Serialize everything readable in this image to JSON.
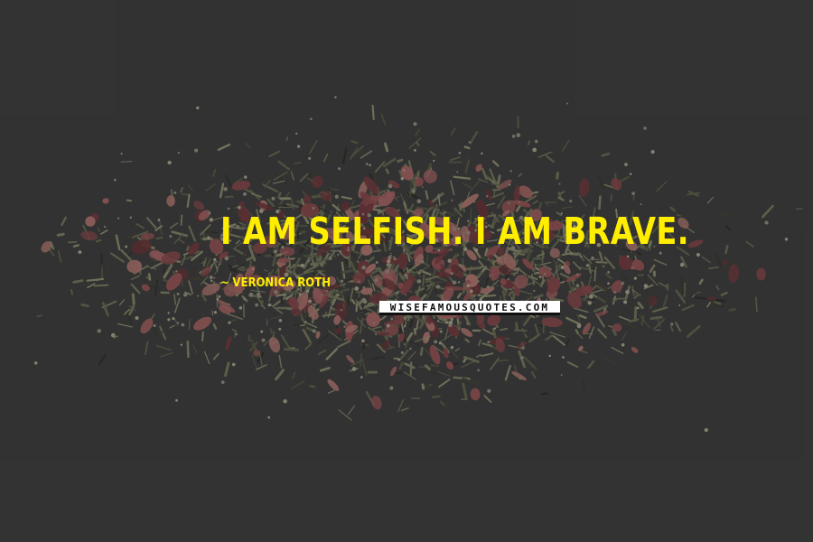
{
  "quote": {
    "text": "I AM SELFISH. I AM BRAVE.",
    "author": "VERONICA ROTH",
    "author_prefix": "~"
  },
  "watermark": {
    "text": "WISEFAMOUSQUOTES.COM"
  },
  "background": {
    "description_icon": "dried-herbs-rose-petals-texture",
    "base_color": "#3f3f3f"
  },
  "colors": {
    "accent_text": "#ffee00"
  }
}
